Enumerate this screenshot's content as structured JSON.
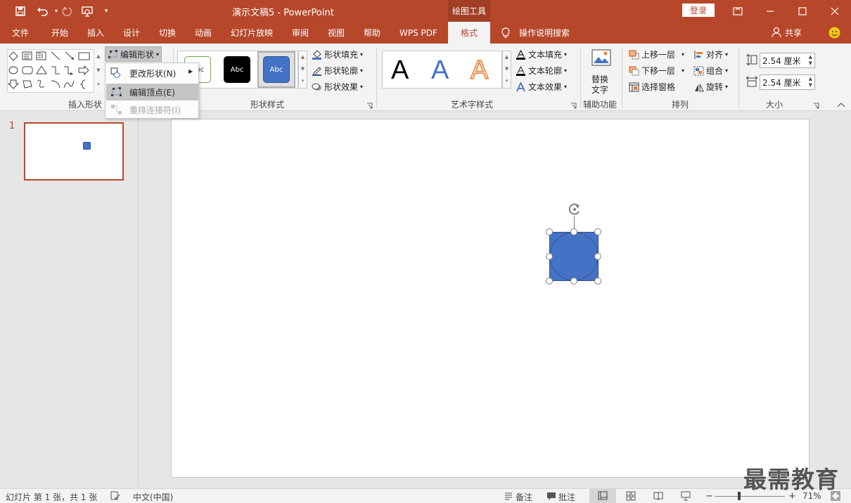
{
  "window": {
    "title": "演示文稿5  -  PowerPoint",
    "context_tab": "绘图工具",
    "login": "登录"
  },
  "tabs": [
    {
      "label": "文件"
    },
    {
      "label": "开始"
    },
    {
      "label": "插入"
    },
    {
      "label": "设计"
    },
    {
      "label": "切换"
    },
    {
      "label": "动画"
    },
    {
      "label": "幻灯片放映"
    },
    {
      "label": "审阅"
    },
    {
      "label": "视图"
    },
    {
      "label": "帮助"
    },
    {
      "label": "WPS PDF"
    },
    {
      "label": "格式",
      "active": true
    }
  ],
  "tell_me": "操作说明搜索",
  "share": "共享",
  "ribbon": {
    "insert_shapes": {
      "label": "插入形状",
      "edit_shape": "编辑形状"
    },
    "shape_styles": {
      "label": "形状样式",
      "items": [
        "Abc",
        "Abc",
        "Abc"
      ],
      "fill": "形状填充",
      "outline": "形状轮廓",
      "effects": "形状效果"
    },
    "wordart_styles": {
      "label": "艺术字样式",
      "letters": [
        "A",
        "A",
        "A"
      ],
      "text_fill": "文本填充",
      "text_outline": "文本轮廓",
      "text_effects": "文本效果"
    },
    "accessibility": {
      "label": "辅助功能",
      "alt_text_line1": "替换",
      "alt_text_line2": "文字"
    },
    "arrange": {
      "label": "排列",
      "bring_forward": "上移一层",
      "send_backward": "下移一层",
      "selection_pane": "选择窗格",
      "align": "对齐",
      "group": "组合",
      "rotate": "旋转"
    },
    "size": {
      "label": "大小",
      "height": "2.54 厘米",
      "width": "2.54 厘米"
    }
  },
  "dropdown": {
    "items": [
      {
        "label": "更改形状(N)",
        "state": "normal"
      },
      {
        "label": "编辑顶点(E)",
        "state": "highlighted"
      },
      {
        "label": "重排连接符(I)",
        "state": "disabled"
      }
    ]
  },
  "thumbnails": [
    {
      "number": "1"
    }
  ],
  "status": {
    "slide_info": "幻灯片 第 1 张，共 1 张",
    "language": "中文(中国)",
    "notes": "备注",
    "comments": "批注",
    "zoom": "71%"
  },
  "watermark": "最需教育",
  "colors": {
    "accent": "#b7472a",
    "shape_fill": "#4472c4",
    "shape_outline": "#2f528f"
  }
}
